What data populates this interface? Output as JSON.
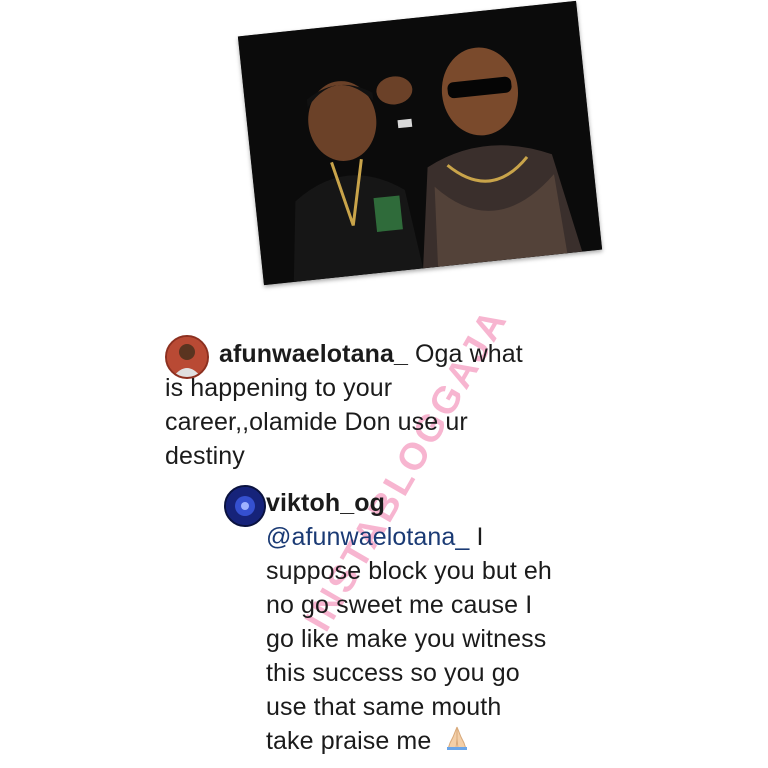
{
  "post_photo": {
    "description_alt": ""
  },
  "comment": {
    "username": "afunwaelotana_",
    "line1": "Oga what",
    "line2": "is happening to your",
    "line3": "career,,olamide Don use ur",
    "line4": "destiny"
  },
  "reply": {
    "username": "viktoh_og",
    "mention": "@afunwaelotana_",
    "line1_rest": " I",
    "line2": "suppose block you but eh",
    "line3": "no go sweet me cause I",
    "line4": "go like make you witness",
    "line5": "this success so you go",
    "line6": "use that same mouth",
    "line7": "take praise me",
    "emoji": "praying-hands"
  },
  "watermark": {
    "text": "INSTABLOGGAJA"
  },
  "colors": {
    "mention": "#1a3a74",
    "watermark": "#f078aa",
    "text": "#1b1b1b"
  }
}
